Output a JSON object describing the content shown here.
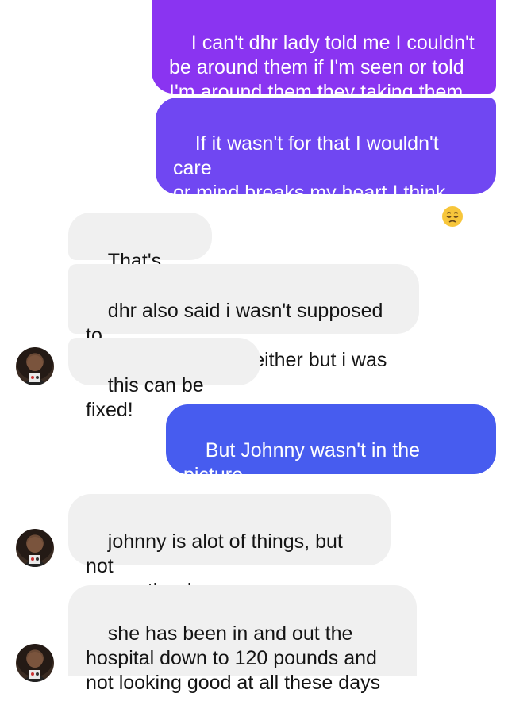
{
  "messages": [
    {
      "id": "m1",
      "sender": "me",
      "text": "I can't dhr lady told me I couldn't\nbe around them if I'm seen or told\nI'm around them they taking them"
    },
    {
      "id": "m2",
      "sender": "me",
      "text": "If it wasn't for that I wouldn't care\nor mind breaks my heart I think\nabout her every day it kills me ",
      "emoji": "pensive-face"
    },
    {
      "id": "m3",
      "sender": "them",
      "text": "That's crazy"
    },
    {
      "id": "m4",
      "sender": "them",
      "text": "dhr also said i wasn't supposed to\nbe around my kids either but i was"
    },
    {
      "id": "m5",
      "sender": "them",
      "text": "this can be fixed!"
    },
    {
      "id": "m6",
      "sender": "me",
      "text": "But Johnny wasn't in the picture\neither he's a pedo"
    },
    {
      "id": "m7",
      "sender": "them",
      "text": "johnny is alot of things, but not\nour mother bre"
    },
    {
      "id": "m8",
      "sender": "them",
      "text": "she has been in and out the\nhospital down to 120 pounds and\nnot looking good at all these days"
    }
  ],
  "colors": {
    "outgoing_top": "#8a34f1",
    "outgoing_mid": "#7047f2",
    "outgoing_bottom": "#475cef",
    "incoming": "#f0f0f0"
  },
  "icons": [
    "avatar",
    "pensive-face-emoji"
  ]
}
